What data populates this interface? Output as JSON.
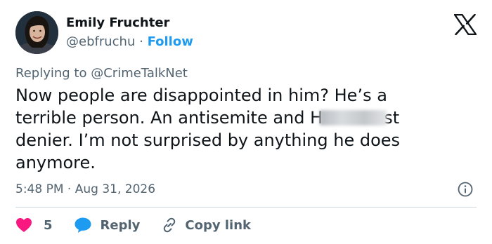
{
  "author": {
    "name": "Emily Fruchter",
    "handle": "@ebfruchu",
    "separator": "·",
    "follow_label": "Follow"
  },
  "brand": {
    "logo_icon": "x-logo-icon"
  },
  "reply_context": {
    "prefix": "Replying to",
    "mention": "@CrimeTalkNet"
  },
  "tweet": {
    "text_part1": "Now people are disappointed in him? He’s a terrible person. An antisemite and H",
    "text_blurred": "olocau",
    "text_part2": "st denier. I’m not surprised by anything he does anymore.",
    "time": "5:48 PM",
    "separator": "·",
    "date": "Aug 31, 2026"
  },
  "actions": {
    "like_count": "5",
    "reply_label": "Reply",
    "copy_link_label": "Copy link"
  },
  "colors": {
    "like": "#f91880",
    "reply": "#1d9bf0",
    "link": "#1d9bf0",
    "muted": "#536471",
    "text": "#0f1419"
  }
}
